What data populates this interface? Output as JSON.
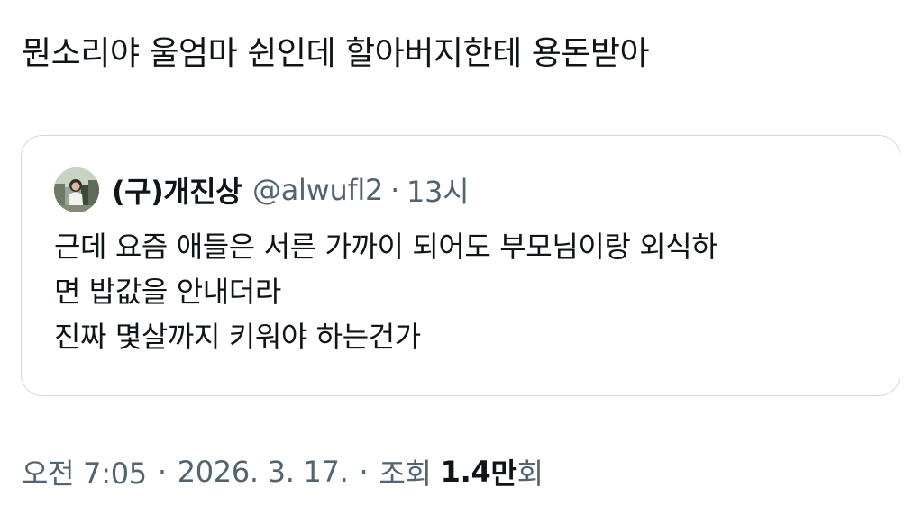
{
  "tweet": {
    "text": "뭔소리야 울엄마 쉰인데 할아버지한테 용돈받아"
  },
  "quote": {
    "display_name": "(구)개진상",
    "handle": "@alwufl2",
    "separator": "·",
    "time_ago": "13시",
    "lines": [
      "근데 요즘 애들은 서른 가까이 되어도 부모님이랑 외식하",
      "면 밥값을 안내더라",
      "진짜 몇살까지 키워야 하는건가"
    ]
  },
  "meta": {
    "time": "오전 7:05",
    "separator": "·",
    "date": "2026. 3. 17.",
    "views_label": "조회",
    "views_count": "1.4",
    "views_unit": "만",
    "views_suffix": "회"
  },
  "colors": {
    "text_primary": "#0f1419",
    "text_secondary": "#536471",
    "border": "#cfd9de"
  }
}
